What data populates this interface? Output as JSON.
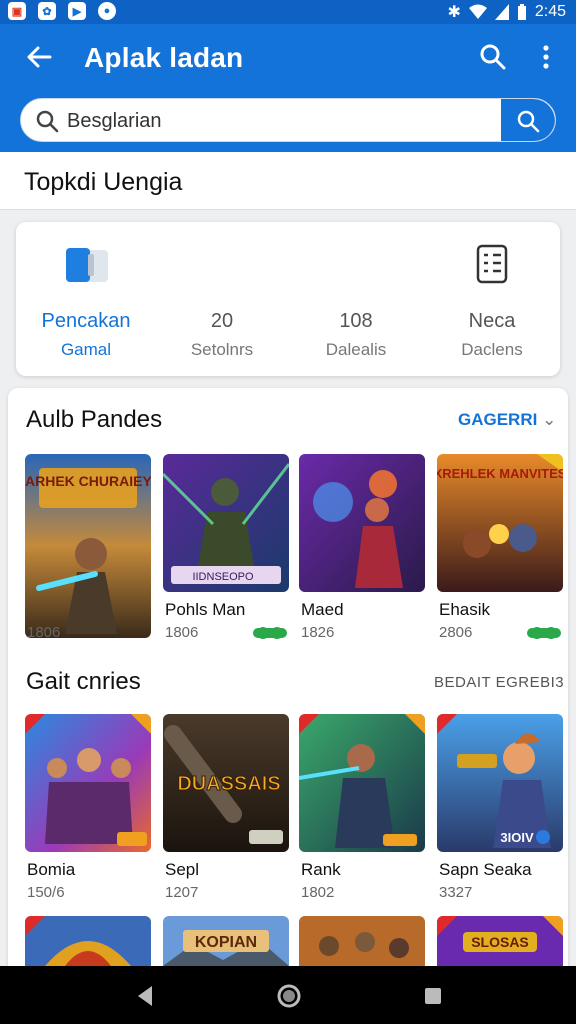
{
  "status_bar": {
    "time": "2:45",
    "icons": [
      "pdf-icon",
      "gallery-icon",
      "play-icon",
      "record-icon",
      "bluetooth-icon",
      "wifi-icon",
      "signal-icon",
      "battery-icon"
    ]
  },
  "app_bar": {
    "title": "Aplak ladan",
    "icons": [
      "back-arrow-icon",
      "search-icon",
      "more-vert-icon"
    ]
  },
  "search": {
    "value": "Besglarian",
    "placeholder": ""
  },
  "section_header": {
    "title": "Topkdi Uengia"
  },
  "stats": [
    {
      "value": "Pencakan",
      "label": "Gamal",
      "icon": "cards-icon",
      "active": true
    },
    {
      "value": "20",
      "label": "Setolnrs"
    },
    {
      "value": "108",
      "label": "Dalealis"
    },
    {
      "value": "Neca",
      "label": "Daclens",
      "icon": "document-list-icon"
    }
  ],
  "section1": {
    "title": "Aulb Pandes",
    "link": "GAGERRI",
    "items": [
      {
        "name": "",
        "count": "1806",
        "banner": "NARHEK CHURAIEYS",
        "accent": "#2f8ad8"
      },
      {
        "name": "Pohls Man",
        "count": "1806",
        "banner": "IIDNSEOPO",
        "accent": "#6a3aa8",
        "badge": true
      },
      {
        "name": "Maed",
        "count": "1826",
        "banner": "",
        "accent": "#8a2a9a"
      },
      {
        "name": "Ehasik",
        "count": "2806",
        "banner": "XREHLEK MANVITES",
        "accent": "#c8641e",
        "badge": true
      }
    ]
  },
  "section2": {
    "title": "Gait cnries",
    "link": "BEDAIT EGREBI3",
    "items": [
      {
        "name": "Bomia",
        "count": "150/6",
        "accent": "#7a38b8"
      },
      {
        "name": "Sepl",
        "count": "1207",
        "banner": "DUASSAIS",
        "accent": "#3a3028"
      },
      {
        "name": "Rank",
        "count": "1802",
        "accent": "#2d6a4a"
      },
      {
        "name": "Sapn Seaka",
        "count": "3327",
        "banner": "3IOIV",
        "accent": "#2a6ac0"
      }
    ]
  },
  "section3": {
    "items": [
      {
        "banner": "",
        "accent": "#c83a1e"
      },
      {
        "banner": "KOPIAN",
        "accent": "#3a6ab8"
      },
      {
        "banner": "",
        "accent": "#b86a2a"
      },
      {
        "banner": "SLOSAS",
        "accent": "#6a2ab0"
      }
    ]
  },
  "nav_bar": {
    "icons": [
      "back-triangle-icon",
      "home-circle-icon",
      "recents-square-icon"
    ]
  }
}
